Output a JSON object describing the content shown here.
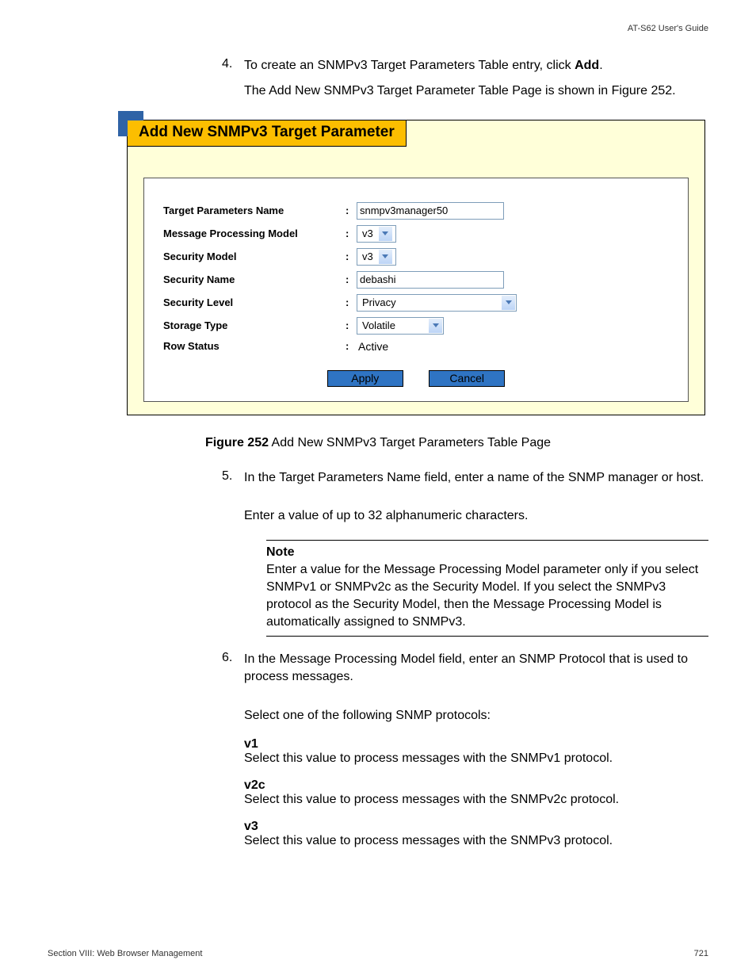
{
  "header": {
    "guide": "AT-S62  User's Guide"
  },
  "steps": {
    "s4": {
      "num": "4.",
      "line1a": "To create an SNMPv3 Target Parameters Table entry, click ",
      "line1b": "Add",
      "line1c": ".",
      "line2": "The Add New SNMPv3 Target Parameter Table Page is shown in Figure 252."
    },
    "s5": {
      "num": "5.",
      "line1": "In the Target Parameters Name field, enter a name of the SNMP manager or host.",
      "line2": "Enter a value of up to 32 alphanumeric characters."
    },
    "s6": {
      "num": "6.",
      "line1": "In the Message Processing Model field, enter an SNMP Protocol that is used to process messages.",
      "line2": "Select one of the following SNMP protocols:"
    }
  },
  "ui": {
    "title": "Add New SNMPv3 Target Parameter",
    "fields": {
      "tpn": {
        "label": "Target Parameters Name",
        "value": "snmpv3manager50"
      },
      "mpm": {
        "label": "Message Processing Model",
        "value": "v3"
      },
      "sm": {
        "label": "Security Model",
        "value": "v3"
      },
      "sn": {
        "label": "Security Name",
        "value": "debashi"
      },
      "sl": {
        "label": "Security Level",
        "value": "Privacy"
      },
      "st": {
        "label": "Storage Type",
        "value": "Volatile"
      },
      "rs": {
        "label": "Row Status",
        "value": "Active"
      }
    },
    "buttons": {
      "apply": "Apply",
      "cancel": "Cancel"
    }
  },
  "figcap": {
    "bold": "Figure 252",
    "rest": "  Add New SNMPv3 Target Parameters Table Page"
  },
  "note": {
    "heading": "Note",
    "body": "Enter a value for the Message Processing Model parameter only if you select SNMPv1 or SNMPv2c as the Security Model. If you select the SNMPv3 protocol as the Security Model, then the Message Processing Model is automatically assigned to SNMPv3."
  },
  "protocols": {
    "v1": {
      "t": "v1",
      "d": "Select this value to process messages with the SNMPv1 protocol."
    },
    "v2c": {
      "t": "v2c",
      "d": "Select this value to process messages with the SNMPv2c protocol."
    },
    "v3": {
      "t": "v3",
      "d": "Select this value to process messages with the SNMPv3 protocol."
    }
  },
  "footer": {
    "section": "Section VIII: Web Browser Management",
    "page": "721"
  }
}
